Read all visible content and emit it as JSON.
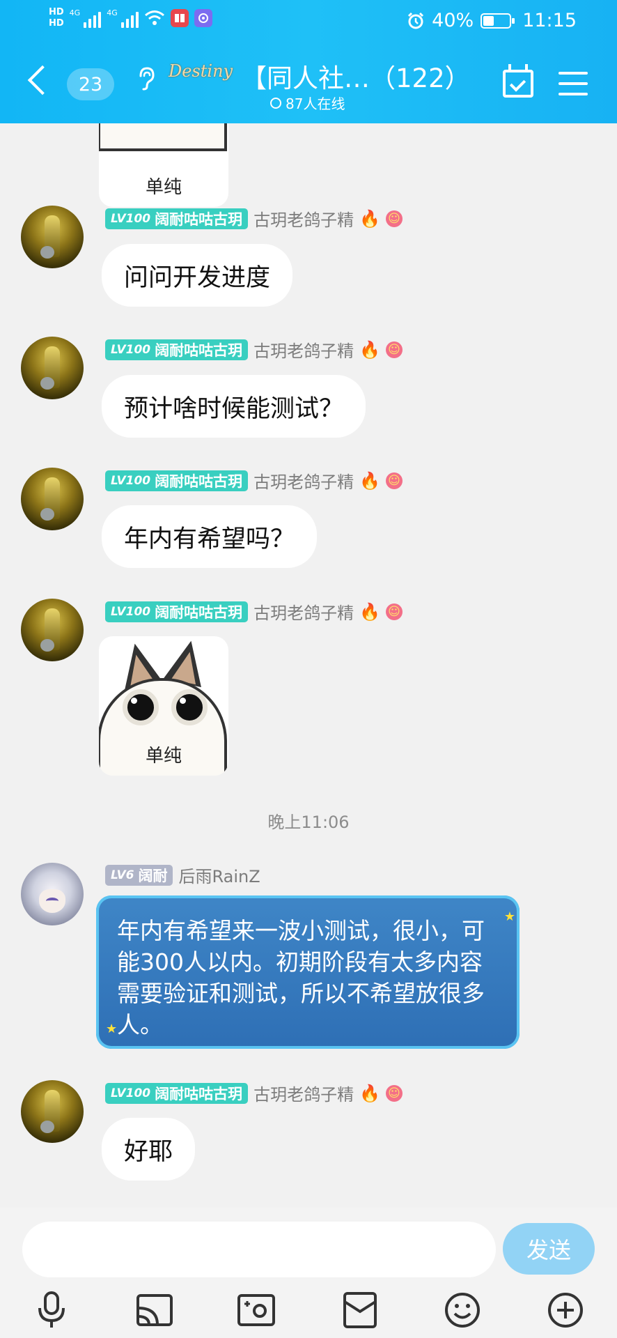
{
  "status_bar": {
    "hd1": "HD",
    "hd2": "HD",
    "net1": "4G",
    "net2": "4G",
    "battery": "40%",
    "battery_level": 0.4,
    "time": "11:15"
  },
  "header": {
    "back_label": "<",
    "unread_count": "23",
    "group_logo_text": "Destiny",
    "title": "【同人社…（122）",
    "online": "87人在线"
  },
  "messages": {
    "m1": {
      "level": "LV100",
      "title": "阔耐咕咕古玥",
      "nick": "古玥老鸽子精"
    },
    "m2": {
      "level": "LV100",
      "title": "阔耐咕咕古玥",
      "nick": "古玥老鸽子精",
      "text": "问问开发进度"
    },
    "m3": {
      "level": "LV100",
      "title": "阔耐咕咕古玥",
      "nick": "古玥老鸽子精",
      "text": "预计啥时候能测试？"
    },
    "m4": {
      "level": "LV100",
      "title": "阔耐咕咕古玥",
      "nick": "古玥老鸽子精",
      "text": "年内有希望吗？"
    },
    "m5": {
      "level": "LV100",
      "title": "阔耐咕咕古玥",
      "nick": "古玥老鸽子精",
      "sticker_text": "单纯"
    },
    "m1_sticker_text": "单纯",
    "timestamp": "晚上11:06",
    "m6": {
      "level": "LV6",
      "title": "阔耐",
      "nick": "后雨RainZ",
      "text": "年内有希望来一波小测试，很小，可能300人以内。初期阶段有太多内容需要验证和测试，所以不希望放很多人。"
    },
    "m7": {
      "level": "LV100",
      "title": "阔耐咕咕古玥",
      "nick": "古玥老鸽子精",
      "text": "好耶"
    }
  },
  "input": {
    "value": "",
    "placeholder": "",
    "send_label": "发送"
  },
  "icons": {
    "fire": "🔥",
    "smile": "☺",
    "ear": "👂",
    "star": "★"
  }
}
